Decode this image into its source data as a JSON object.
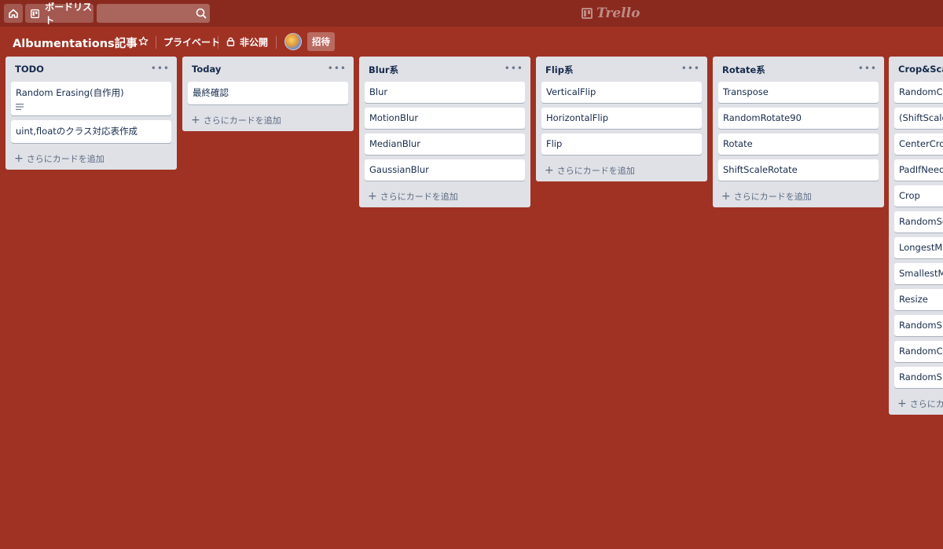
{
  "topbar": {
    "home_icon": "home-icon",
    "boards_label": "ボードリスト",
    "search_placeholder": "",
    "logo_text": "Trello"
  },
  "board": {
    "title": "Albumentations記事",
    "visibility_label": "プライベート",
    "privacy_label": "非公開",
    "invite_label": "招待"
  },
  "add_card_label": "さらにカードを追加",
  "lists": [
    {
      "title": "TODO",
      "cards": [
        "Random Erasing(自作用)",
        "uint,floatのクラス対応表作成"
      ]
    },
    {
      "title": "Today",
      "cards": [
        "最終確認"
      ]
    },
    {
      "title": "Blur系",
      "cards": [
        "Blur",
        "MotionBlur",
        "MedianBlur",
        "GaussianBlur"
      ]
    },
    {
      "title": "Flip系",
      "cards": [
        "VerticalFlip",
        "HorizontalFlip",
        "Flip"
      ]
    },
    {
      "title": "Rotate系",
      "cards": [
        "Transpose",
        "RandomRotate90",
        "Rotate",
        "ShiftScaleRotate"
      ]
    },
    {
      "title": "Crop&Scal",
      "cards": [
        "RandomCro",
        "(ShiftScale",
        "CenterCrop",
        "PadIfNeede",
        "Crop",
        "RandomSca",
        "LongestMa",
        "SmallestMa",
        "Resize",
        "RandomSiz",
        "RandomCro",
        "RandomSiz"
      ]
    }
  ],
  "last_list_add_label": "さらにカー",
  "colors": {
    "board_bg": "#a03224",
    "topbar_bg": "#8a2a1f",
    "list_bg": "#dfe1e6"
  }
}
